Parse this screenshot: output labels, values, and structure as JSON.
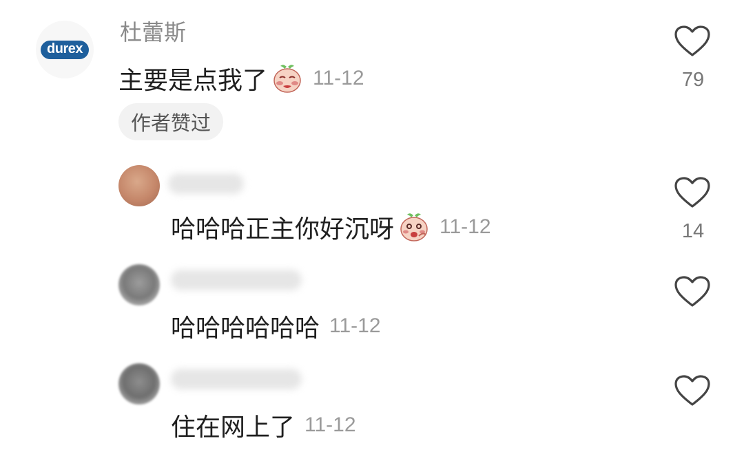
{
  "comments": [
    {
      "username": "杜蕾斯",
      "avatar_text": "durex",
      "text": "主要是点我了",
      "date": "11-12",
      "likes": "79",
      "badge": "作者赞过",
      "emoji": "shy-peach-emoji"
    },
    {
      "username": "",
      "text": "哈哈哈正主你好沉呀",
      "date": "11-12",
      "likes": "14",
      "emoji": "laughing-peach-emoji"
    },
    {
      "username": "",
      "text": "哈哈哈哈哈哈",
      "date": "11-12",
      "likes": ""
    },
    {
      "username": "",
      "text": "住在网上了",
      "date": "11-12",
      "likes": ""
    }
  ],
  "icons": {
    "like": "heart-outline-icon"
  },
  "colors": {
    "brand_durex": "#1e5f9c",
    "username_gray": "#8a8a8a",
    "date_gray": "#9a9a9a",
    "badge_bg": "#f2f2f2"
  }
}
